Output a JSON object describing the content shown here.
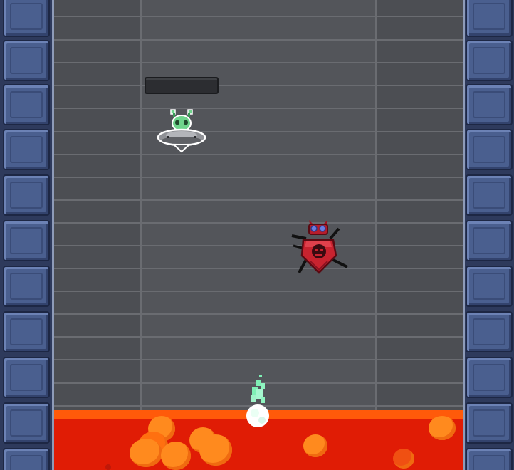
{
  "game": {
    "enemies": [
      {
        "name": "alien-ufo",
        "color": "#6fd48c"
      },
      {
        "name": "red-spider-robot",
        "color": "#c8232f"
      }
    ],
    "player": {
      "name": "flame-wisp",
      "color": "#7ff0b5"
    },
    "hazard": {
      "name": "lava",
      "color": "#e01c05"
    },
    "health_bar": {
      "fill_fraction": 0
    }
  },
  "colors": {
    "wall": "#4a5f8f",
    "floor": "#4c4e53",
    "lava_surface": "#ff5a0a",
    "lava_bubble": "#ff8a1e"
  }
}
